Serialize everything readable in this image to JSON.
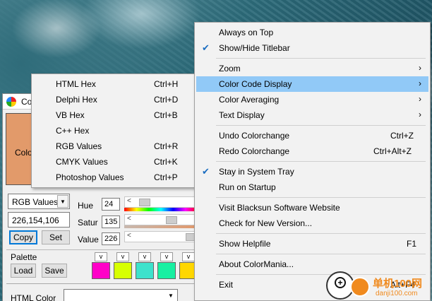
{
  "window": {
    "title": "Co",
    "swatch_label": "Colo",
    "swatch_color": "#e29a6a",
    "format_value": "RGB Values",
    "code_value": "226,154,106",
    "copy_label": "Copy",
    "set_label": "Set",
    "hue_label": "Hue",
    "hue_value": "24",
    "sat_label": "Satur",
    "sat_value": "135",
    "val_label": "Value",
    "val_value": "226",
    "arrow_glyph": "<",
    "palette_label": "Palette",
    "palette_v": [
      "v",
      "v",
      "v",
      "v",
      "v"
    ],
    "palette_colors": [
      "#ff00c8",
      "#d7ff00",
      "#3de2cc",
      "#18f0a2",
      "#ffd700"
    ],
    "load_label": "Load",
    "save_label": "Save",
    "html_color_label": "HTML Color"
  },
  "submenu": {
    "items": [
      {
        "label": "HTML Hex",
        "shortcut": "Ctrl+H"
      },
      {
        "label": "Delphi Hex",
        "shortcut": "Ctrl+D"
      },
      {
        "label": "VB Hex",
        "shortcut": "Ctrl+B"
      },
      {
        "label": "C++ Hex",
        "shortcut": ""
      },
      {
        "label": "RGB Values",
        "shortcut": "Ctrl+R"
      },
      {
        "label": "CMYK Values",
        "shortcut": "Ctrl+K"
      },
      {
        "label": "Photoshop Values",
        "shortcut": "Ctrl+P"
      }
    ]
  },
  "menu": {
    "always_on_top": "Always on Top",
    "show_hide_titlebar": "Show/Hide Titlebar",
    "zoom": "Zoom",
    "color_code_display": "Color Code Display",
    "color_averaging": "Color Averaging",
    "text_display": "Text Display",
    "undo": "Undo Colorchange",
    "undo_sc": "Ctrl+Z",
    "redo": "Redo Colorchange",
    "redo_sc": "Ctrl+Alt+Z",
    "stay_in_tray": "Stay in System Tray",
    "run_on_startup": "Run on Startup",
    "visit_website": "Visit Blacksun Software Website",
    "check_version": "Check for New Version...",
    "show_helpfile": "Show Helpfile",
    "helpfile_sc": "F1",
    "about": "About ColorMania...",
    "exit": "Exit",
    "exit_sc": "Alt+F4",
    "chevron": "›",
    "check": "✔",
    "highlight_color": "#91c9f7"
  },
  "watermark": {
    "text": "单机100网",
    "url": "danji100.com"
  }
}
